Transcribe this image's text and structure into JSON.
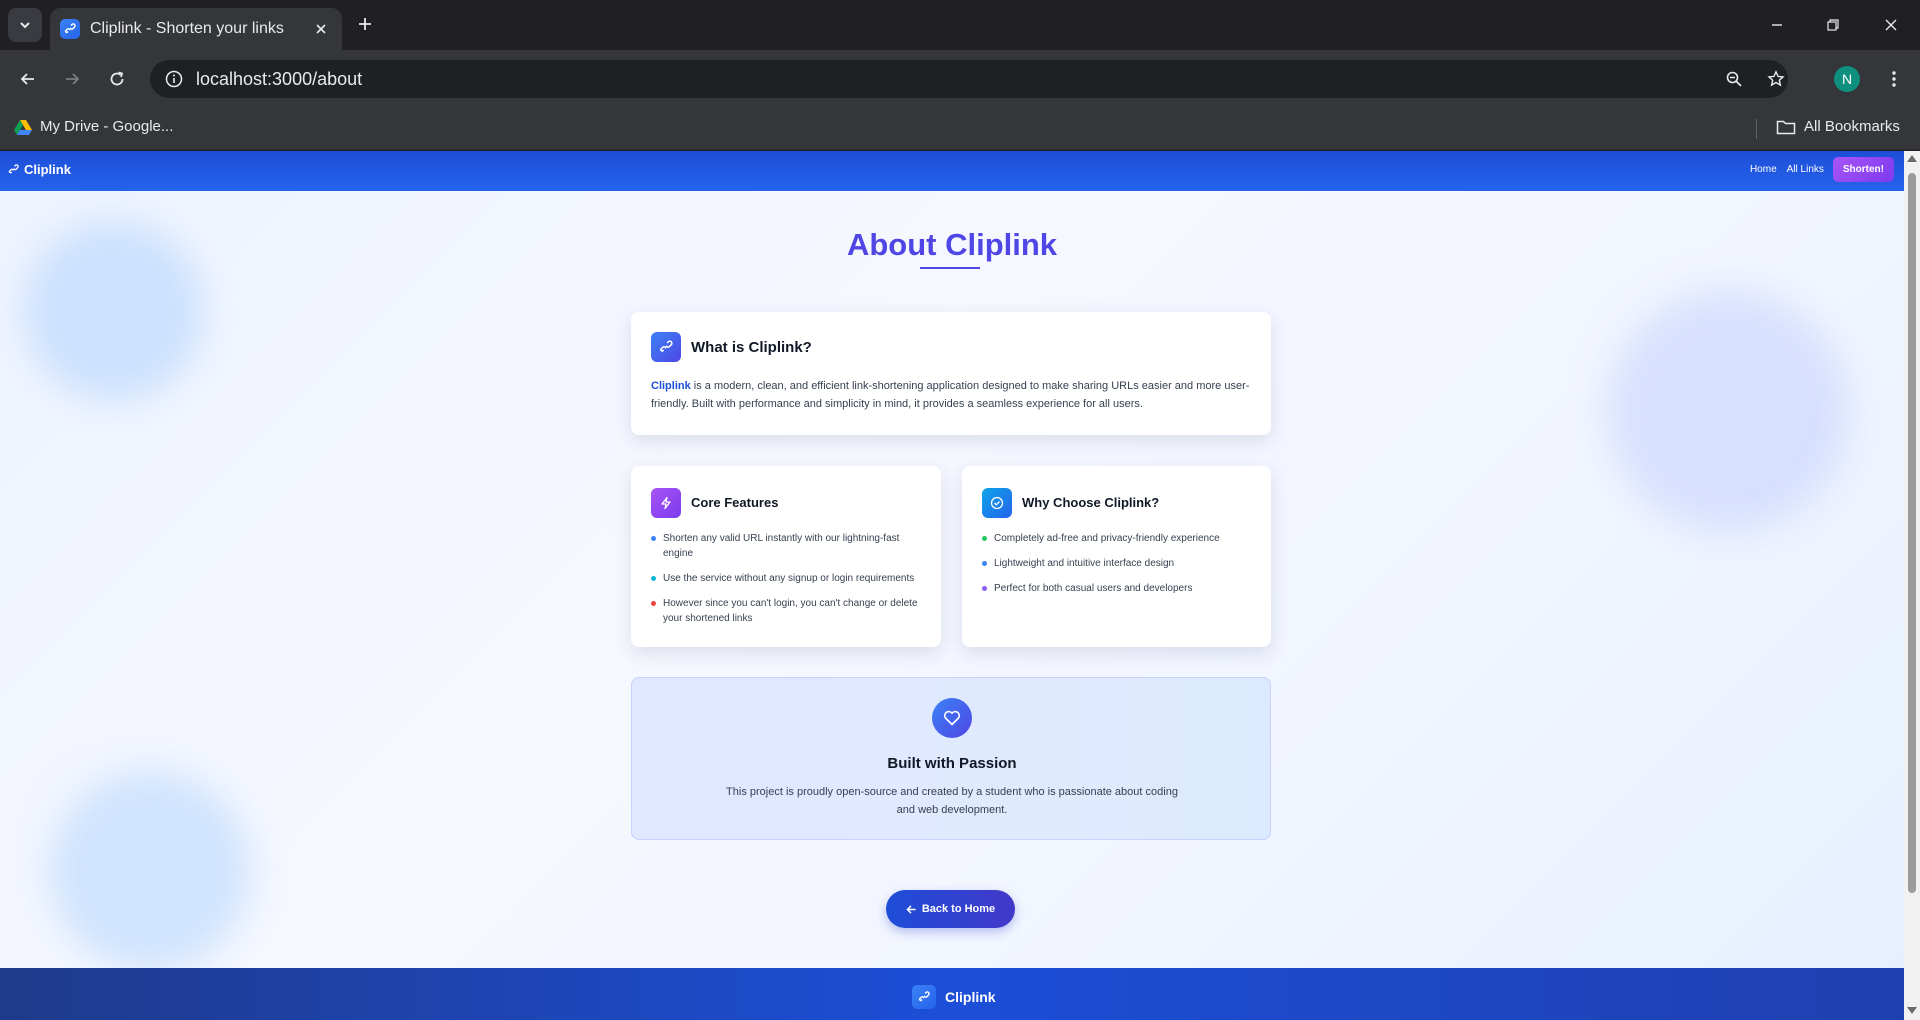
{
  "browser": {
    "tab_title": "Cliplink - Shorten your links",
    "url": "localhost:3000/about",
    "profile_initial": "N",
    "bookmarks": {
      "drive_label": "My Drive - Google...",
      "all_label": "All Bookmarks"
    }
  },
  "nav": {
    "brand": "Cliplink",
    "links": [
      "Home",
      "All Links"
    ],
    "cta": "Shorten!"
  },
  "page": {
    "title": "About Cliplink",
    "what": {
      "heading": "What is Cliplink?",
      "highlight": "Cliplink",
      "text": " is a modern, clean, and efficient link-shortening application designed to make sharing URLs easier and more user-friendly. Built with performance and simplicity in mind, it provides a seamless experience for all users."
    },
    "core": {
      "heading": "Core Features",
      "items": [
        "Shorten any valid URL instantly with our lightning-fast engine",
        "Use the service without any signup or login requirements",
        "However since you can't login, you can't change or delete your shortened links"
      ],
      "dot_colors": [
        "#3b82f6",
        "#06b6d4",
        "#ef4444"
      ]
    },
    "why": {
      "heading": "Why Choose Cliplink?",
      "items": [
        "Completely ad-free and privacy-friendly experience",
        "Lightweight and intuitive interface design",
        "Perfect for both casual users and developers"
      ],
      "dot_colors": [
        "#22c55e",
        "#3b82f6",
        "#8b5cf6"
      ]
    },
    "passion": {
      "heading": "Built with Passion",
      "text": "This project is proudly open-source and created by a student who is passionate about coding and web development."
    },
    "back_button": "Back to Home"
  },
  "footer": {
    "brand": "Cliplink"
  },
  "colors": {
    "accent": "#4f46e5",
    "nav_bg": "#2563eb",
    "cta": "#8b5cf6"
  }
}
